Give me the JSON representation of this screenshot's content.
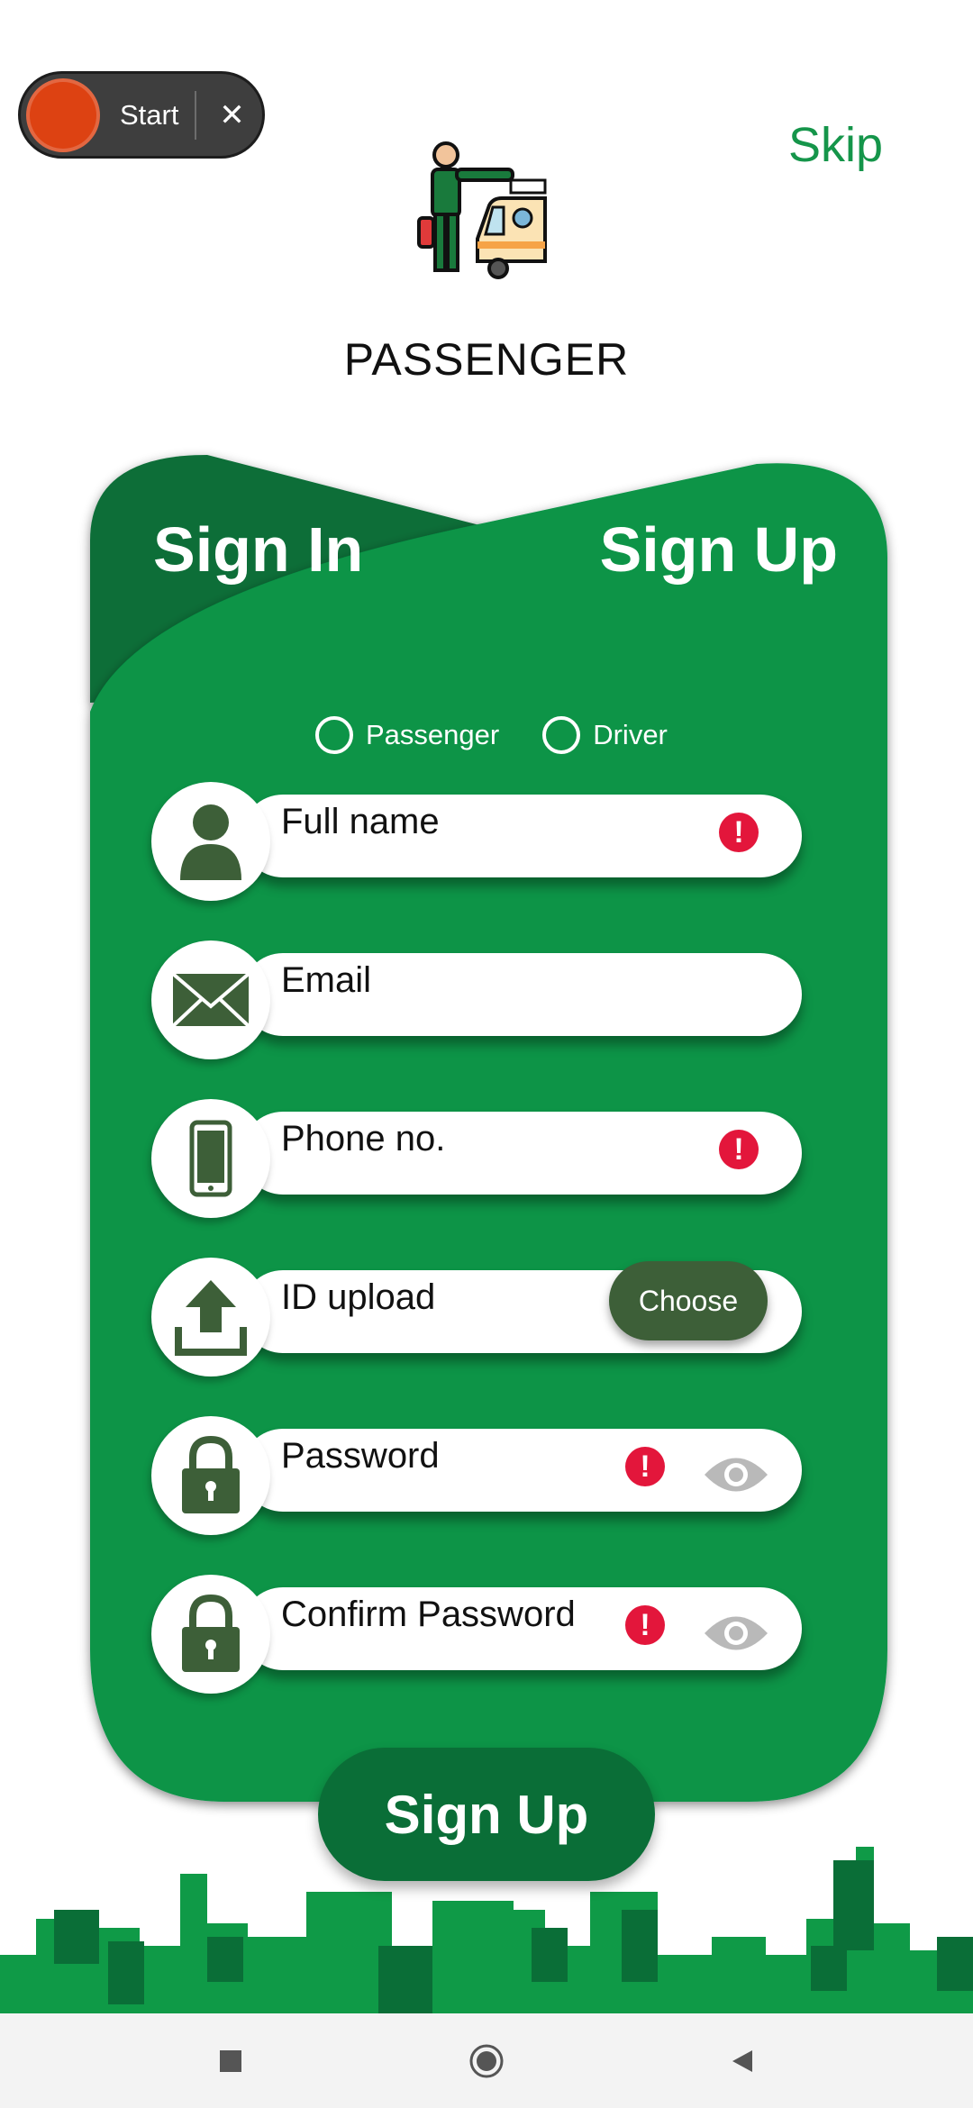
{
  "recorder": {
    "label": "Start",
    "close": "✕"
  },
  "header": {
    "skip": "Skip",
    "role_title": "PASSENGER"
  },
  "tabs": {
    "sign_in": "Sign In",
    "sign_up": "Sign Up"
  },
  "account_type": {
    "options": [
      "Passenger",
      "Driver"
    ]
  },
  "fields": {
    "full_name": {
      "label": "Full name",
      "error": "!"
    },
    "email": {
      "label": "Email"
    },
    "phone": {
      "label": "Phone no.",
      "error": "!"
    },
    "id_upload": {
      "label": "ID upload",
      "button": "Choose"
    },
    "password": {
      "label": "Password",
      "error": "!"
    },
    "confirm_password": {
      "label": "Confirm Password",
      "error": "!"
    }
  },
  "submit": {
    "label": "Sign Up"
  },
  "colors": {
    "primary_green": "#079446",
    "dark_green": "#0a6e37",
    "error_red": "#e3163b"
  },
  "icons": [
    "person-icon",
    "envelope-icon",
    "phone-icon",
    "upload-icon",
    "lock-icon",
    "eye-icon",
    "alert-icon"
  ]
}
